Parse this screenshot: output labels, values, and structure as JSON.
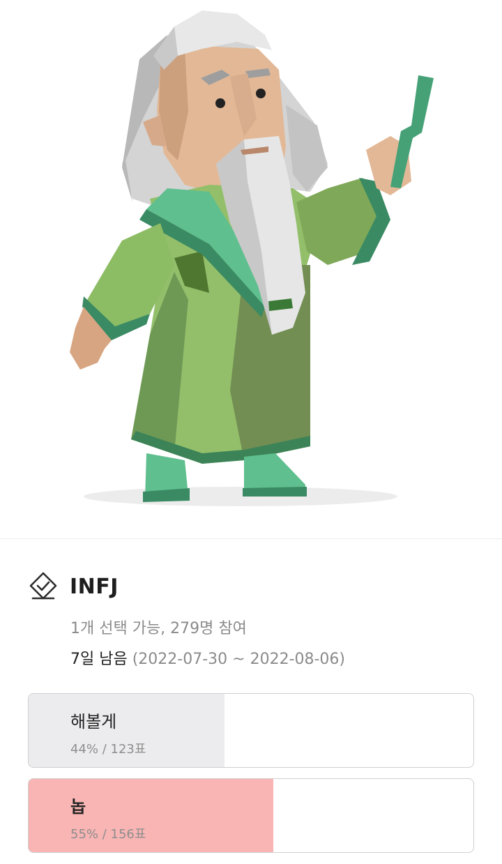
{
  "poll": {
    "title": "INFJ",
    "meta": "1개 선택 가능, 279명 참여",
    "remaining": "7일 남음",
    "period": "(2022-07-30 ~ 2022-08-06)",
    "options": [
      {
        "label": "해볼게",
        "result": "44% / 123표",
        "percent": 44,
        "selected": false,
        "fill_color": "#ececee"
      },
      {
        "label": "놉",
        "result": "55% / 156표",
        "percent": 55,
        "selected": true,
        "fill_color": "#f8b5b4"
      }
    ]
  },
  "icons": {
    "vote": "checkbox-diamond-icon",
    "hero": "wizard-illustration"
  }
}
